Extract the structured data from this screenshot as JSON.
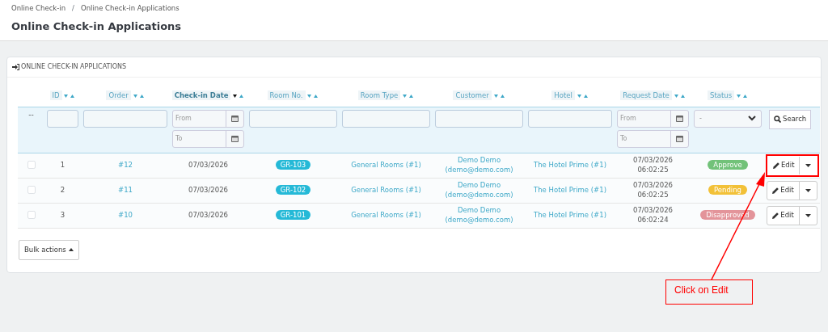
{
  "breadcrumb": [
    "Online Check-in",
    "Online Check-in Applications"
  ],
  "breadcrumb_separator": "/",
  "page_title": "Online Check-in Applications",
  "panel": {
    "title": "ONLINE CHECK-IN APPLICATIONS"
  },
  "table": {
    "columns": [
      {
        "label": "ID",
        "sorted": false
      },
      {
        "label": "Order",
        "sorted": false
      },
      {
        "label": "Check-in Date",
        "sorted": true
      },
      {
        "label": "Room No.",
        "sorted": false
      },
      {
        "label": "Room Type",
        "sorted": false
      },
      {
        "label": "Customer",
        "sorted": false
      },
      {
        "label": "Hotel",
        "sorted": false
      },
      {
        "label": "Request Date",
        "sorted": false
      },
      {
        "label": "Status",
        "sorted": false
      }
    ],
    "filters": {
      "reset": "--",
      "cells": [
        {
          "kind": "text"
        },
        {
          "kind": "text"
        },
        {
          "kind": "daterange",
          "from": "From",
          "to": "To"
        },
        {
          "kind": "text"
        },
        {
          "kind": "text"
        },
        {
          "kind": "text"
        },
        {
          "kind": "text"
        },
        {
          "kind": "daterange",
          "from": "From",
          "to": "To"
        },
        {
          "kind": "select",
          "value": "-"
        }
      ],
      "search_button": "Search"
    },
    "rows": [
      {
        "selected": false,
        "id": "1",
        "order": "#12",
        "checkin_date": "07/03/2026",
        "room_no": "GR-103",
        "room_type": "General Rooms (#1)",
        "customer_name": "Demo Demo",
        "customer_email": "(demo@demo.com)",
        "hotel": "The Hotel Prime (#1)",
        "request_date": "07/03/2026",
        "request_time": "06:02:25",
        "status": "Approve",
        "color": "#72c279",
        "edit": "Edit",
        "highlighted": true
      },
      {
        "selected": false,
        "id": "2",
        "order": "#11",
        "checkin_date": "07/03/2026",
        "room_no": "GR-102",
        "room_type": "General Rooms (#1)",
        "customer_name": "Demo Demo",
        "customer_email": "(demo@demo.com)",
        "hotel": "The Hotel Prime (#1)",
        "request_date": "07/03/2026",
        "request_time": "06:02:25",
        "status": "Pending",
        "color": "#f2c138",
        "edit": "Edit",
        "highlighted": false
      },
      {
        "selected": false,
        "id": "3",
        "order": "#10",
        "checkin_date": "07/03/2026",
        "room_no": "GR-101",
        "room_type": "General Rooms (#1)",
        "customer_name": "Demo Demo",
        "customer_email": "(demo@demo.com)",
        "hotel": "The Hotel Prime (#1)",
        "request_date": "07/03/2026",
        "request_time": "06:02:24",
        "status": "Disapproved",
        "color": "#e3949a",
        "edit": "Edit",
        "highlighted": false
      }
    ]
  },
  "bulk_actions": "Bulk actions",
  "annotation": {
    "text": "Click on Edit"
  }
}
